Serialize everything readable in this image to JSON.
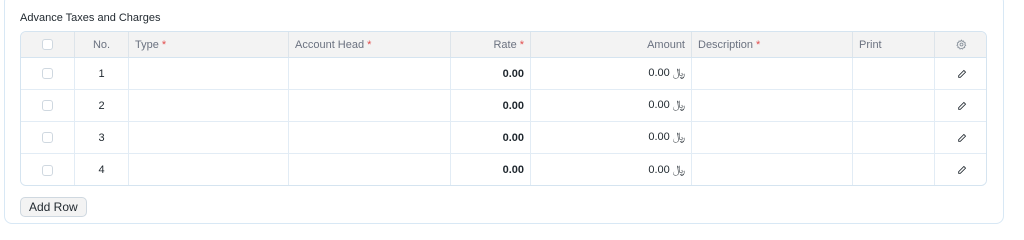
{
  "section": {
    "title": "Advance Taxes and Charges"
  },
  "grid": {
    "columns": {
      "no": "No.",
      "type": "Type",
      "account_head": "Account Head",
      "rate": "Rate",
      "amount": "Amount",
      "description": "Description",
      "print": "Print",
      "required_marker": "*"
    },
    "rows": [
      {
        "no": "1",
        "rate": "0.00",
        "amount": "0.00 ﷼"
      },
      {
        "no": "2",
        "rate": "0.00",
        "amount": "0.00 ﷼"
      },
      {
        "no": "3",
        "rate": "0.00",
        "amount": "0.00 ﷼"
      },
      {
        "no": "4",
        "rate": "0.00",
        "amount": "0.00 ﷼"
      }
    ]
  },
  "actions": {
    "add_row": "Add Row"
  },
  "icons": {
    "settings": "gear-icon",
    "edit": "pencil-icon"
  },
  "colors": {
    "required": "#e24c4c",
    "border": "#d5e4f0",
    "header_bg": "#f3f3f3"
  }
}
